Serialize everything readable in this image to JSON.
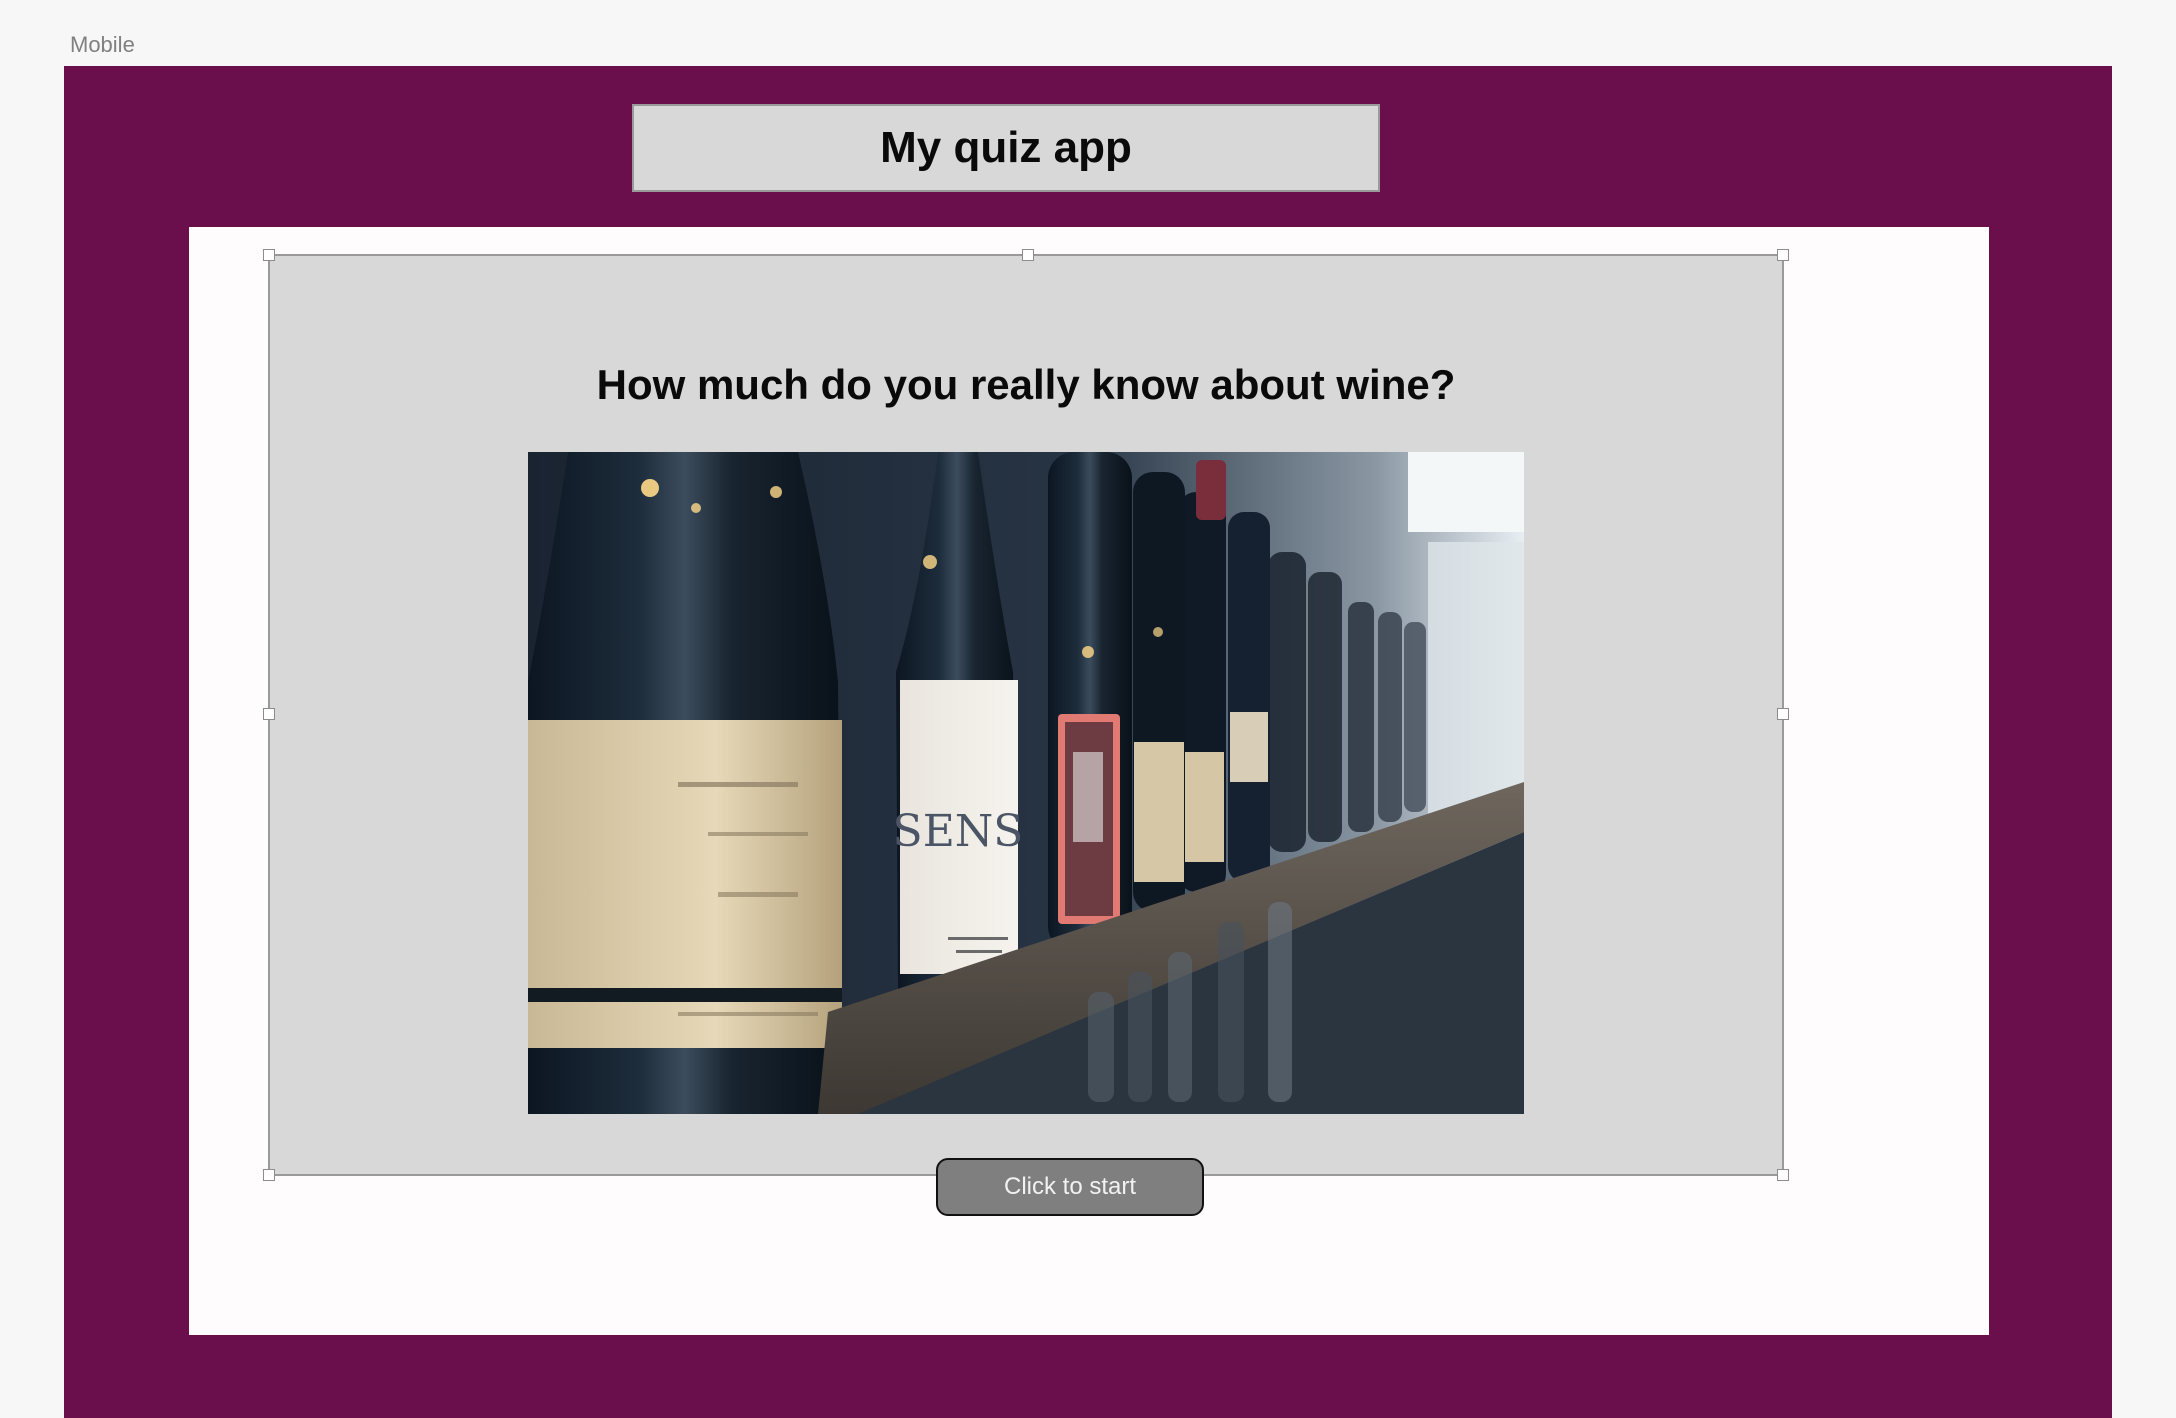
{
  "canvas": {
    "artboard_label": "Mobile"
  },
  "header": {
    "title": "My quiz app"
  },
  "quiz": {
    "question": "How much do you really know about wine?",
    "image_alt": "Wine bottles on a shelf",
    "bottle_label_text": "SENS",
    "start_button_label": "Click to start"
  },
  "colors": {
    "artboard_background": "#6b0f4c",
    "panel_background": "#fffcfd",
    "card_background": "#d8d8d8",
    "button_background": "#7f7f7f"
  }
}
